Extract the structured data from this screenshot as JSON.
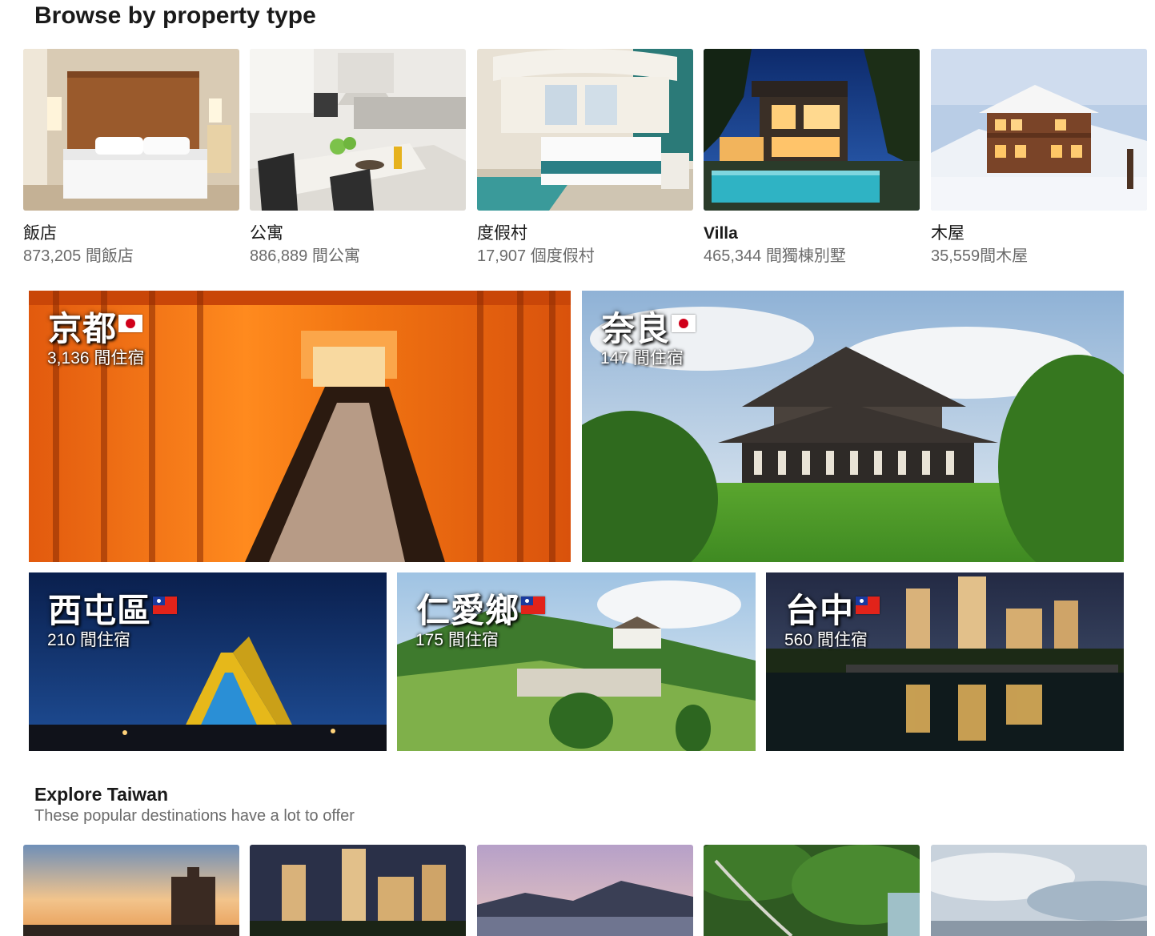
{
  "browse": {
    "title": "Browse by property type",
    "types": [
      {
        "name": "飯店",
        "count": "873,205 間飯店"
      },
      {
        "name": "公寓",
        "count": "886,889 間公寓"
      },
      {
        "name": "度假村",
        "count": "17,907 個度假村"
      },
      {
        "name": "Villa",
        "count": "465,344 間獨棟別墅"
      },
      {
        "name": "木屋",
        "count": "35,559間木屋"
      }
    ]
  },
  "destinations": [
    {
      "name": "京都",
      "count": "3,136 間住宿",
      "flag": "japan-flag-icon"
    },
    {
      "name": "奈良",
      "count": "147 間住宿",
      "flag": "japan-flag-icon"
    },
    {
      "name": "西屯區",
      "count": "210 間住宿",
      "flag": "taiwan-flag-icon"
    },
    {
      "name": "仁愛鄉",
      "count": "175 間住宿",
      "flag": "taiwan-flag-icon"
    },
    {
      "name": "台中",
      "count": "560 間住宿",
      "flag": "taiwan-flag-icon"
    }
  ],
  "explore": {
    "title": "Explore Taiwan",
    "subtitle": "These popular destinations have a lot to offer"
  },
  "colors": {
    "heading": "#1a1a1a",
    "muted": "#6b6b6b",
    "torii_orange": "#f06a10",
    "grass_green": "#5aa62e"
  }
}
